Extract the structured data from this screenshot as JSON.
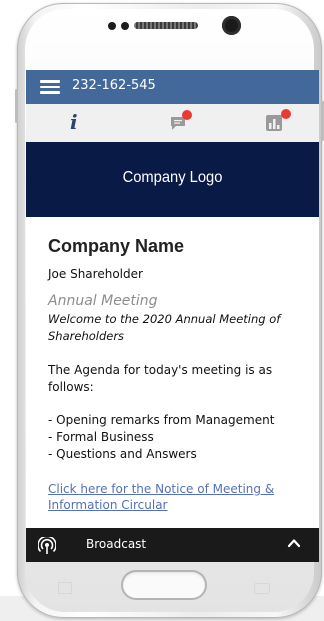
{
  "topbar": {
    "meeting_id": "232-162-545"
  },
  "tabs": [
    {
      "icon": "info-icon"
    },
    {
      "icon": "chat-icon",
      "badge": true
    },
    {
      "icon": "chart-icon",
      "badge": true
    }
  ],
  "logo": {
    "text": "Company Logo"
  },
  "content": {
    "company_name": "Company Name",
    "shareholder": "Joe Shareholder",
    "meeting_title": "Annual Meeting",
    "welcome": "Welcome to the 2020 Annual Meeting of Shareholders",
    "agenda_intro": "The Agenda for today's meeting is as follows:",
    "agenda_items": [
      "- Opening remarks from Management",
      "- Formal Business",
      "- Questions and Answers"
    ],
    "notice_link": "Click here for the Notice of Meeting & Information Circular"
  },
  "broadcast": {
    "label": "Broadcast"
  },
  "colors": {
    "topbar": "#42699a",
    "logo_banner": "#0a1a47",
    "badge": "#ea3a32",
    "link": "#5470b8",
    "broadcast_bar": "#1a1a1a"
  }
}
